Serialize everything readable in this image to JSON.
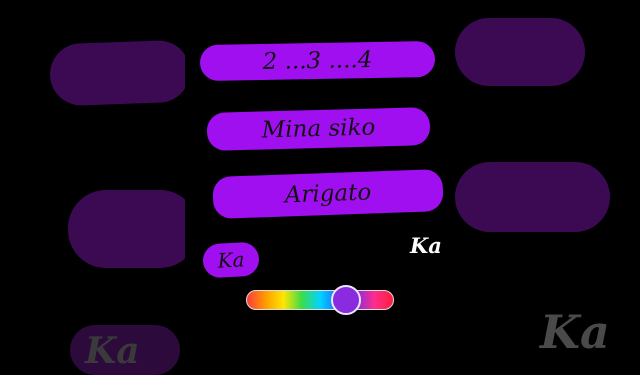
{
  "labels": {
    "line1": "2 ...3 ....4",
    "line2": "Mina  siko",
    "line3": "Arigato",
    "line4": "Ka",
    "floating": "Ka",
    "ghost_large": "Ka",
    "ghost_small": "Ka"
  },
  "slider": {
    "value": 0.72
  },
  "colors": {
    "pill": "#a00ff0",
    "ghost": "#3b0a52",
    "background": "#000000",
    "thumb": "#8b2be0"
  }
}
